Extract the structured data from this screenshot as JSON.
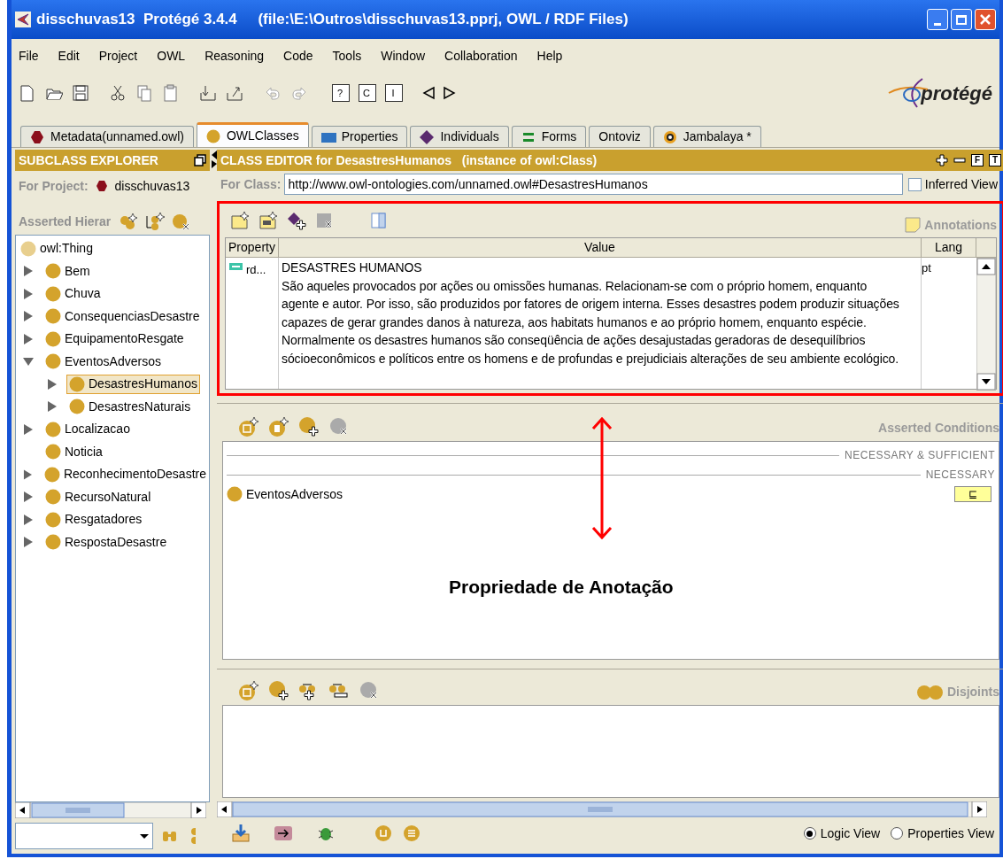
{
  "window": {
    "title": "disschuvas13  Protégé 3.4.4     (file:\\E:\\Outros\\disschuvas13.pprj, OWL / RDF Files)"
  },
  "menu": [
    "File",
    "Edit",
    "Project",
    "OWL",
    "Reasoning",
    "Code",
    "Tools",
    "Window",
    "Collaboration",
    "Help"
  ],
  "toolbar": {
    "glyph_buttons": [
      "?",
      "C",
      "I"
    ],
    "logo": "protégé"
  },
  "tabs": [
    {
      "label": "Metadata(unnamed.owl)",
      "kind": "hexagon",
      "selected": false
    },
    {
      "label": "OWLClasses",
      "kind": "circle",
      "selected": true
    },
    {
      "label": "Properties",
      "kind": "rect",
      "selected": false
    },
    {
      "label": "Individuals",
      "kind": "diamond",
      "selected": false
    },
    {
      "label": "Forms",
      "kind": "bars",
      "selected": false
    },
    {
      "label": "Ontoviz",
      "kind": "none",
      "selected": false
    },
    {
      "label": "Jambalaya *",
      "kind": "target",
      "selected": false
    }
  ],
  "subclass_explorer": {
    "title": "SUBCLASS EXPLORER",
    "project_label": "For Project:",
    "project_name": "disschuvas13",
    "hierarchy_label": "Asserted Hierar",
    "tree": {
      "name": "owl:Thing",
      "selected": false,
      "children": [
        {
          "name": "Bem",
          "expanded": false,
          "selected": false
        },
        {
          "name": "Chuva",
          "expanded": false,
          "selected": false
        },
        {
          "name": "ConsequenciasDesastre",
          "expanded": false,
          "selected": false
        },
        {
          "name": "EquipamentoResgate",
          "expanded": false,
          "selected": false
        },
        {
          "name": "EventosAdversos",
          "expanded": true,
          "selected": false,
          "children": [
            {
              "name": "DesastresHumanos",
              "expanded": false,
              "selected": true
            },
            {
              "name": "DesastresNaturais",
              "expanded": false,
              "selected": false
            }
          ]
        },
        {
          "name": "Localizacao",
          "expanded": false,
          "selected": false
        },
        {
          "name": "Noticia",
          "selected": false
        },
        {
          "name": "ReconhecimentoDesastre",
          "expanded": false,
          "selected": false
        },
        {
          "name": "RecursoNatural",
          "expanded": false,
          "selected": false
        },
        {
          "name": "Resgatadores",
          "expanded": false,
          "selected": false
        },
        {
          "name": "RespostaDesastre",
          "expanded": false,
          "selected": false
        }
      ]
    }
  },
  "class_editor": {
    "title": "CLASS EDITOR for DesastresHumanos   (instance of owl:Class)",
    "header_buttons": [
      "F",
      "T"
    ],
    "for_class_label": "For Class:",
    "for_class_value": "http://www.owl-ontologies.com/unnamed.owl#DesastresHumanos",
    "inferred_view": {
      "label": "Inferred View",
      "checked": false
    }
  },
  "annotations": {
    "label": "Annotations",
    "columns": [
      "Property",
      "Value",
      "Lang"
    ],
    "rows": [
      {
        "property": "rd...",
        "value_title": "DESASTRES HUMANOS",
        "value": "São aqueles provocados por ações ou omissões humanas. Relacionam-se com o próprio homem, enquanto agente e autor. Por isso, são produzidos por fatores de origem interna. Esses desastres podem produzir situações capazes de gerar grandes danos à natureza, aos habitats humanos e ao próprio homem, enquanto espécie. Normalmente os desastres humanos são conseqüência de ações desajustadas geradoras de desequilíbrios sócioeconômicos e políticos entre os homens e de profundas e prejudiciais alterações de seu ambiente ecológico.",
        "lang": "pt"
      }
    ]
  },
  "conditions": {
    "label": "Asserted Conditions",
    "sections": [
      {
        "title": "NECESSARY & SUFFICIENT"
      },
      {
        "title": "NECESSARY",
        "items": [
          {
            "name": "EventosAdversos",
            "badge": "⊑"
          }
        ]
      }
    ]
  },
  "disjoints": {
    "label": "Disjoints"
  },
  "views": [
    {
      "label": "Logic View",
      "selected": true
    },
    {
      "label": "Properties View",
      "selected": false
    }
  ],
  "callout": {
    "text": "Propriedade de Anotação"
  }
}
